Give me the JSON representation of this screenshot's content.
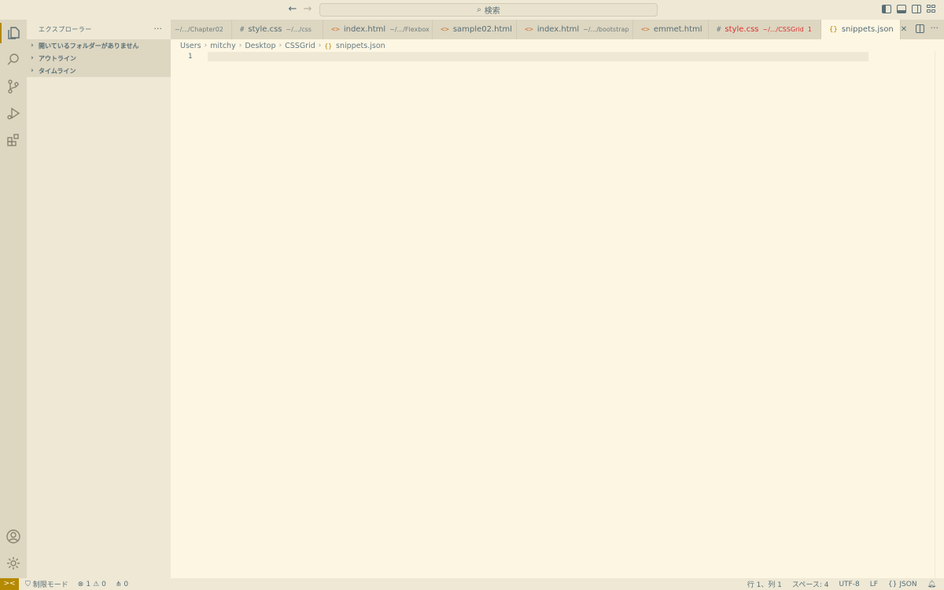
{
  "titlebar": {
    "search_label": "検索",
    "back_icon": "arrow-left-icon",
    "forward_icon": "arrow-right-icon"
  },
  "sidebar": {
    "title": "エクスプローラー",
    "more": "···",
    "sections": [
      {
        "label": "開いているフォルダーがありません"
      },
      {
        "label": "アウトライン"
      },
      {
        "label": "タイムライン"
      }
    ]
  },
  "tabs": [
    {
      "icon": "",
      "name": "",
      "desc": "~/.../Chapter02"
    },
    {
      "icon": "#",
      "name": "style.css",
      "desc": "~/.../css"
    },
    {
      "icon": "<>",
      "name": "index.html",
      "desc": "~/.../Flexbox"
    },
    {
      "icon": "<>",
      "name": "sample02.html",
      "desc": ""
    },
    {
      "icon": "<>",
      "name": "index.html",
      "desc": "~/.../bootstrap"
    },
    {
      "icon": "<>",
      "name": "emmet.html",
      "desc": ""
    },
    {
      "icon": "#",
      "name": "style.css",
      "desc": "~/.../CSSGrid",
      "badge": "1"
    },
    {
      "icon": "{}",
      "name": "snippets.json",
      "desc": "",
      "close": "✕"
    }
  ],
  "breadcrumb": [
    "Users",
    "mitchy",
    "Desktop",
    "CSSGrid",
    "snippets.json"
  ],
  "editor": {
    "line_numbers": [
      "1"
    ]
  },
  "statusbar": {
    "remote": "><",
    "restricted": "制限モード",
    "errors": "1",
    "warnings": "0",
    "ports": "0",
    "position": "行 1、列 1",
    "spaces": "スペース: 4",
    "encoding": "UTF-8",
    "eol": "LF",
    "language": "JSON"
  },
  "colors": {
    "background": "#fdf6e3",
    "sidebar": "#eee8d5",
    "activitybar": "#ddd6c1",
    "accent": "#b58900",
    "error": "#dc322f"
  }
}
